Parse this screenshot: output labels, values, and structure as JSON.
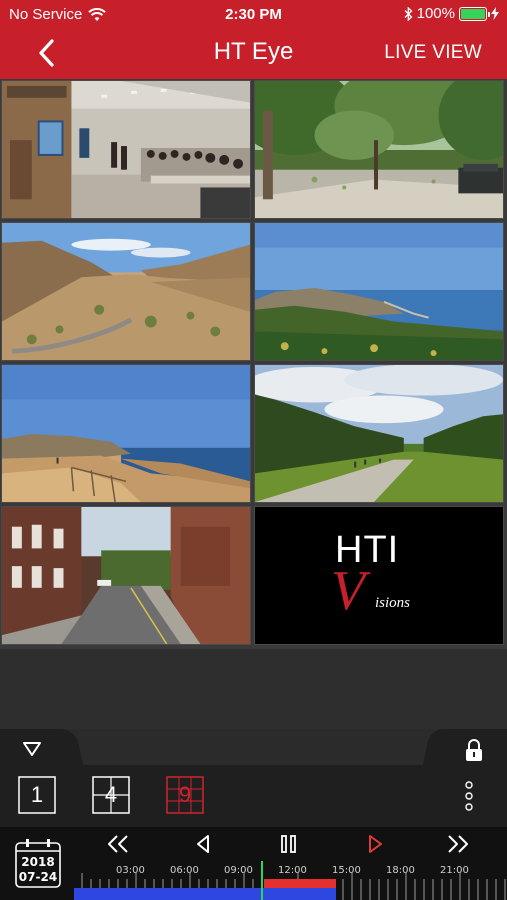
{
  "status_bar": {
    "carrier": "No Service",
    "time": "2:30 PM",
    "battery": "100%"
  },
  "nav": {
    "title": "HT Eye",
    "right_action": "LIVE VIEW",
    "back_icon": "chevron-left-icon"
  },
  "cameras": [
    {
      "id": 1,
      "scene": "office-training-room"
    },
    {
      "id": 2,
      "scene": "park-path-trees"
    },
    {
      "id": 3,
      "scene": "desert-hills-road"
    },
    {
      "id": 4,
      "scene": "coastal-cliffs"
    },
    {
      "id": 5,
      "scene": "beach-boardwalk"
    },
    {
      "id": 6,
      "scene": "tree-lined-path"
    },
    {
      "id": 7,
      "scene": "brick-street"
    },
    {
      "id": 8,
      "scene": "logo"
    }
  ],
  "logo": {
    "line1": "HTI",
    "line2": "V",
    "line3": "isions"
  },
  "layout_buttons": [
    {
      "label": "1",
      "selected": false
    },
    {
      "label": "4",
      "selected": false
    },
    {
      "label": "9",
      "selected": true
    }
  ],
  "calendar": {
    "year": "2018",
    "date": "07-24"
  },
  "timeline": {
    "ticks": [
      "03:00",
      "06:00",
      "09:00",
      "12:00",
      "15:00",
      "18:00",
      "21:00"
    ],
    "recording_segments": [
      {
        "type": "normal",
        "color": "#2e47e0"
      },
      {
        "type": "event",
        "color": "#e53030"
      }
    ]
  },
  "colors": {
    "brand": "#c8202b",
    "selected_layout": "#d0232e",
    "play_icon": "#e03a3a",
    "cursor": "#2bd45a"
  }
}
